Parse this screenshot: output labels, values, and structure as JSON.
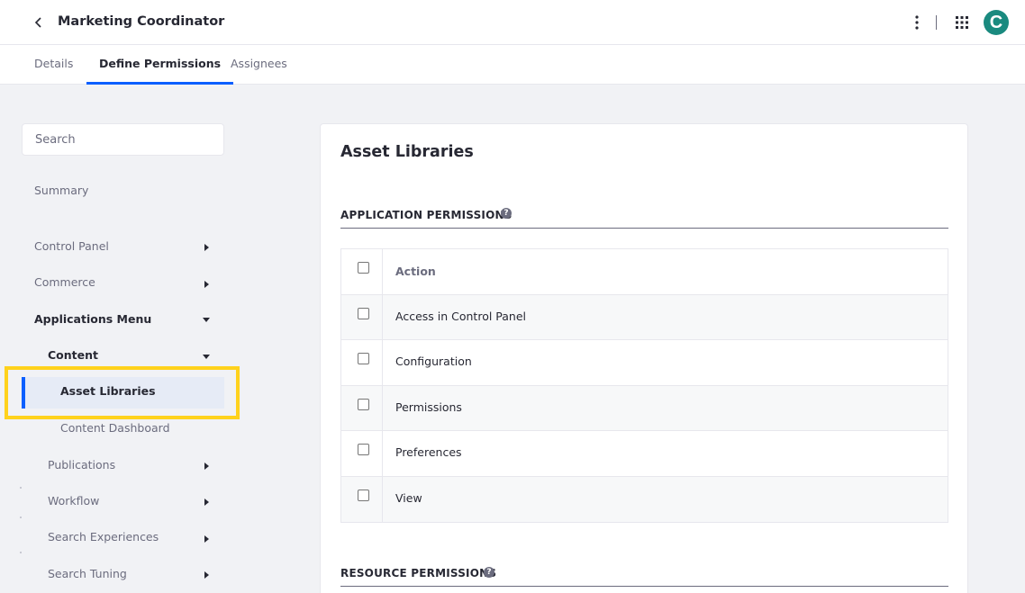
{
  "header": {
    "title": "Marketing Coordinator",
    "back_icon": "chevron-left-icon",
    "options_icon": "ellipsis-v-icon",
    "apps_icon": "grid-icon",
    "avatar_initial": "C"
  },
  "tabs": [
    {
      "label": "Details"
    },
    {
      "label": "Define Permissions",
      "active": true
    },
    {
      "label": "Assignees"
    }
  ],
  "sidebar": {
    "search_placeholder": "Search",
    "items": [
      {
        "label": "Summary"
      },
      {
        "label": "Control Panel"
      },
      {
        "label": "Commerce"
      },
      {
        "label": "Applications Menu"
      },
      {
        "label": "Content"
      },
      {
        "label": "Asset Libraries"
      },
      {
        "label": "Content Dashboard"
      },
      {
        "label": "Publications"
      },
      {
        "label": "Workflow"
      },
      {
        "label": "Search Experiences"
      },
      {
        "label": "Search Tuning"
      }
    ]
  },
  "main": {
    "title": "Asset Libraries",
    "application_permissions": {
      "heading": "APPLICATION PERMISSIONS",
      "column_header": "Action",
      "rows": [
        {
          "label": "Access in Control Panel"
        },
        {
          "label": "Configuration"
        },
        {
          "label": "Permissions"
        },
        {
          "label": "Preferences"
        },
        {
          "label": "View"
        }
      ]
    },
    "resource_permissions": {
      "heading": "RESOURCE PERMISSIONS"
    },
    "help_glyph": "?"
  },
  "colors": {
    "accent": "#0b5fff",
    "highlight": "#ffd21c",
    "avatar": "#1a8a7f"
  }
}
